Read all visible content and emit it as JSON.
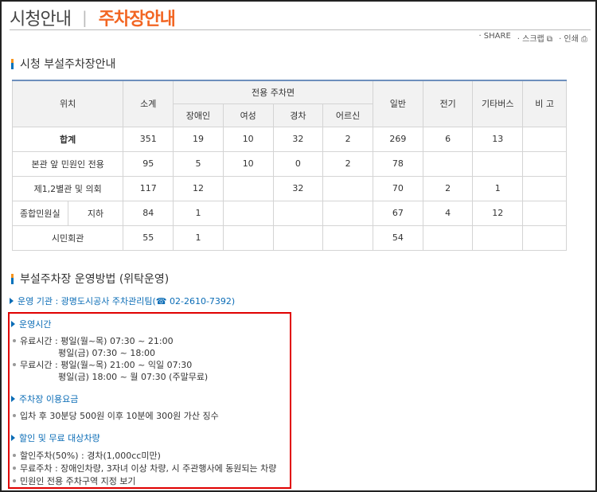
{
  "header": {
    "title": "시청안내",
    "separator": "|",
    "subtitle": "주차장안내"
  },
  "utility": {
    "share": "· SHARE",
    "scrap": "· 스크랩 ⧉",
    "print": "· 인쇄 ⎙"
  },
  "section1": {
    "title": "시청 부설주차장안내"
  },
  "table": {
    "headers": {
      "location": "위치",
      "subtotal": "소계",
      "dedicated": "전용 주차면",
      "disabled": "장애인",
      "women": "여성",
      "compact": "경차",
      "senior": "어르신",
      "general": "일반",
      "ev": "전기",
      "other_bus": "기타버스",
      "remarks": "비 고"
    },
    "rows": [
      {
        "loc": "합계",
        "subtotal": "351",
        "disabled": "19",
        "women": "10",
        "compact": "32",
        "senior": "2",
        "general": "269",
        "ev": "6",
        "bus": "13",
        "remark": ""
      },
      {
        "loc": "본관 앞 민원인 전용",
        "subtotal": "95",
        "disabled": "5",
        "women": "10",
        "compact": "0",
        "senior": "2",
        "general": "78",
        "ev": "",
        "bus": "",
        "remark": ""
      },
      {
        "loc": "제1,2별관 및 의회",
        "subtotal": "117",
        "disabled": "12",
        "women": "",
        "compact": "32",
        "senior": "",
        "general": "70",
        "ev": "2",
        "bus": "1",
        "remark": ""
      },
      {
        "loc": "종합민원실",
        "loc2": "지하",
        "subtotal": "84",
        "disabled": "1",
        "women": "",
        "compact": "",
        "senior": "",
        "general": "67",
        "ev": "4",
        "bus": "12",
        "remark": ""
      },
      {
        "loc": "시민회관",
        "subtotal": "55",
        "disabled": "1",
        "women": "",
        "compact": "",
        "senior": "",
        "general": "54",
        "ev": "",
        "bus": "",
        "remark": ""
      }
    ]
  },
  "section2": {
    "title": "부설주차장 운영방법 (위탁운영)"
  },
  "operator": "운영 기관 : 광명도시공사 주차관리팀(☎ 02-2610-7392)",
  "hours": {
    "title": "운영시간",
    "paid_label": "유료시간 : 평일(월~목) 07:30 ~ 21:00",
    "paid_fri": "평일(금) 07:30 ~ 18:00",
    "free_label": "무료시간 : 평일(월~목) 21:00 ~ 익일 07:30",
    "free_fri": "평일(금) 18:00 ~ 월 07:30 (주말무료)"
  },
  "fee": {
    "title": "주차장 이용요금",
    "line": "입차 후 30분당 500원 이후 10분에 300원 가산 징수"
  },
  "discount": {
    "title": "할인 및 무료 대상차량",
    "line1": "할인주차(50%) : 경차(1,000cc미만)",
    "line2": "무료주차 : 장애인차량, 3자녀 이상 차량, 시 주관행사에 동원되는 차량",
    "line3": "민원인 전용 주차구역 지정 보기"
  },
  "colors": {
    "accent": "#f26522",
    "link": "#0a6cb6",
    "highlight_box": "#e00000",
    "table_top": "#6d8fbd"
  }
}
